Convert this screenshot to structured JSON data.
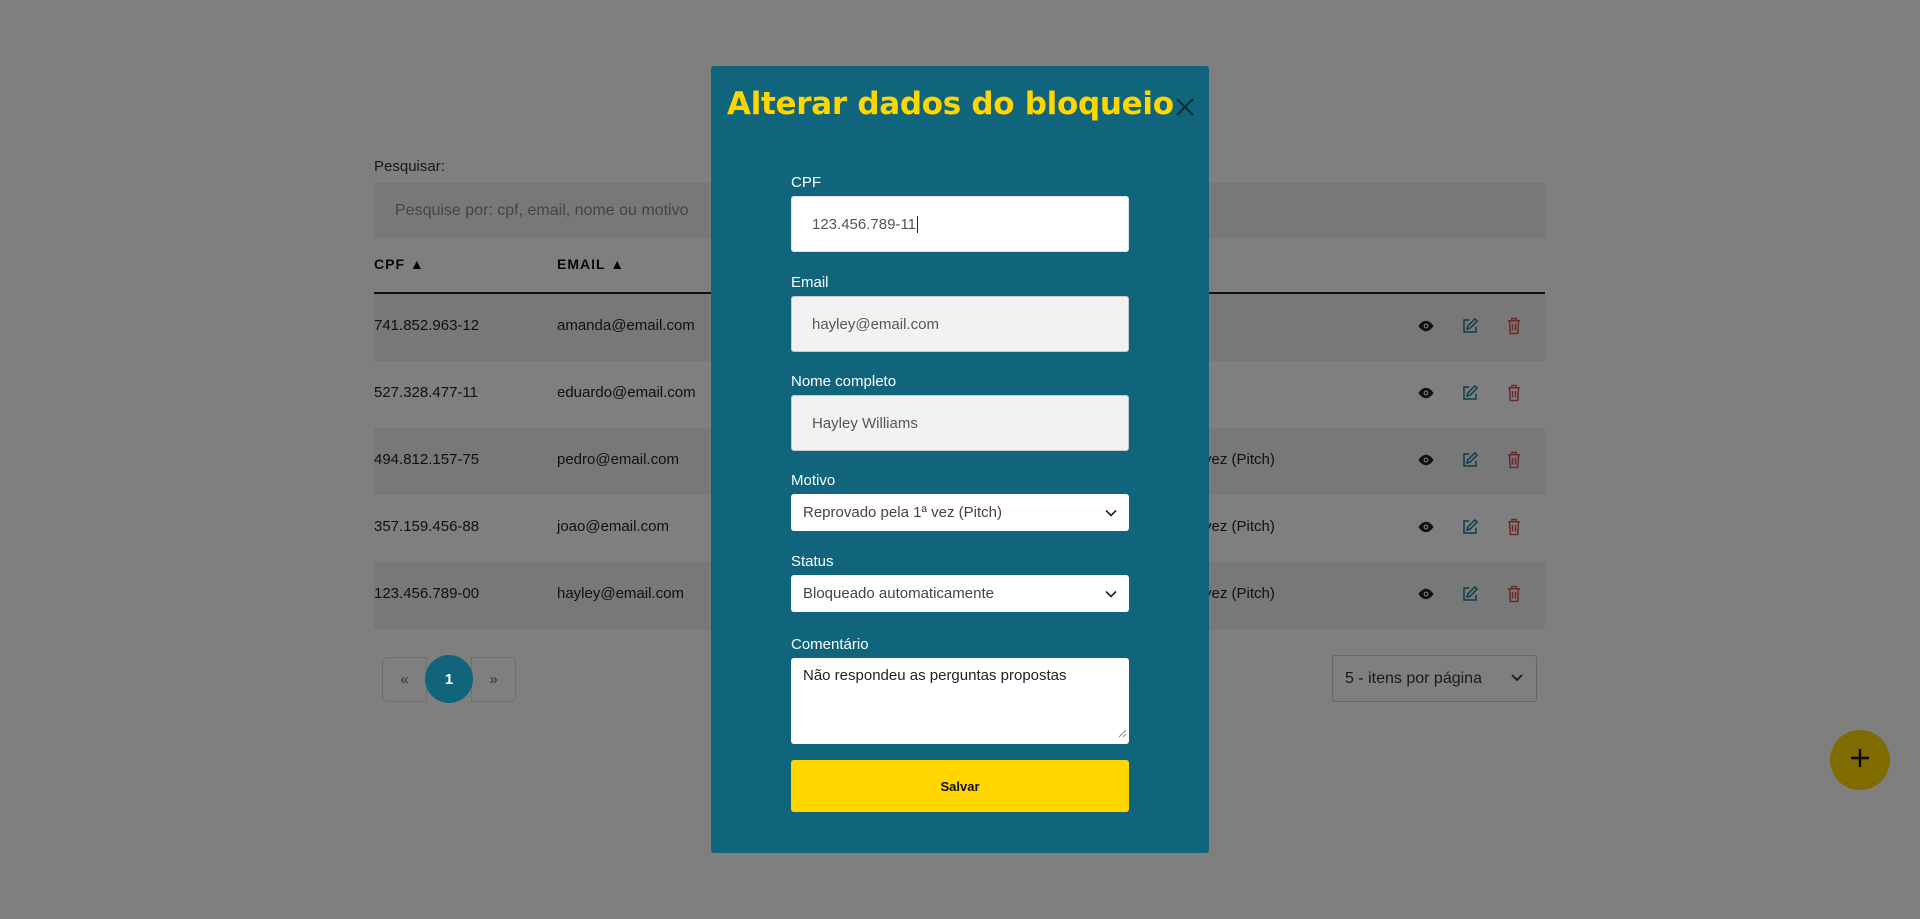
{
  "page": {
    "search_label": "Pesquisar:",
    "search_placeholder": "Pesquise por: cpf, email, nome ou motivo",
    "table": {
      "headers": {
        "cpf": "CPF ▲",
        "email": "EMAIL ▲"
      },
      "rows": [
        {
          "cpf": "741.852.963-12",
          "email": "amanda@email.com",
          "motivo": ""
        },
        {
          "cpf": "527.328.477-11",
          "email": "eduardo@email.com",
          "motivo": ""
        },
        {
          "cpf": "494.812.157-75",
          "email": "pedro@email.com",
          "motivo": "vez (Pitch)"
        },
        {
          "cpf": "357.159.456-88",
          "email": "joao@email.com",
          "motivo": "vez (Pitch)"
        },
        {
          "cpf": "123.456.789-00",
          "email": "hayley@email.com",
          "motivo": "vez (Pitch)"
        }
      ]
    },
    "pagination": {
      "prev": "«",
      "current": "1",
      "next": "»"
    },
    "per_page": "5 - itens por página",
    "fab_icon": "plus-icon"
  },
  "modal": {
    "title": "Alterar dados do bloqueio",
    "close_icon": "close-icon",
    "fields": {
      "cpf": {
        "label": "CPF",
        "value": "123.456.789-11"
      },
      "email": {
        "label": "Email",
        "value": "hayley@email.com"
      },
      "nome": {
        "label": "Nome completo",
        "value": "Hayley Williams"
      },
      "motivo": {
        "label": "Motivo",
        "value": "Reprovado pela 1ª vez (Pitch)"
      },
      "status": {
        "label": "Status",
        "value": "Bloqueado automaticamente"
      },
      "comentario": {
        "label": "Comentário",
        "value": "Não respondeu as perguntas propostas"
      }
    },
    "save_label": "Salvar"
  },
  "colors": {
    "modal_bg": "#10657d",
    "accent_yellow": "#ffd600",
    "edit_icon": "#1b7a96",
    "delete_icon": "#d9534f"
  }
}
